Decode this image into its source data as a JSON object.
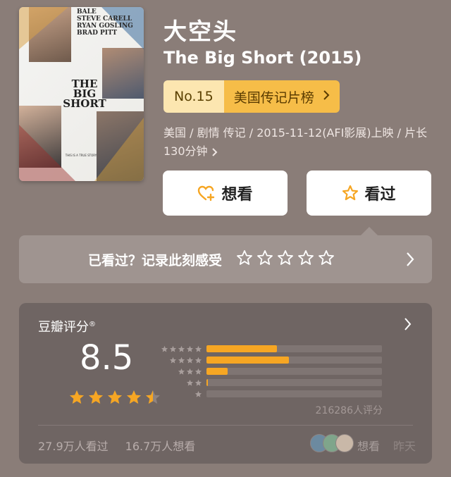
{
  "poster": {
    "names": [
      "BALE",
      "STEVE CARELL",
      "RYAN GOSLING",
      "BRAD PITT"
    ],
    "title": "THE BIG SHORT",
    "credits": "THIS IS A TRUE STORY"
  },
  "movie": {
    "title": "大空头",
    "subtitle": "The Big Short (2015)",
    "rank_no": "No.15",
    "rank_list": "美国传记片榜",
    "meta": "美国 / 剧情 传记 / 2015-11-12(AFI影展)上映 / 片长130分钟"
  },
  "actions": {
    "want_label": "想看",
    "seen_label": "看过"
  },
  "record": {
    "label": "已看过？记录此刻感受"
  },
  "rating": {
    "header": "豆瓣评分",
    "registered": "®",
    "score": "8.5",
    "stars_value": 4.5,
    "distribution": [
      {
        "stars": 5,
        "fraction": 0.4
      },
      {
        "stars": 4,
        "fraction": 0.47
      },
      {
        "stars": 3,
        "fraction": 0.12
      },
      {
        "stars": 2,
        "fraction": 0.01
      },
      {
        "stars": 1,
        "fraction": 0.0
      }
    ],
    "count": "216286人评分",
    "seen_count": "27.9万人看过",
    "want_count": "16.7万人想看",
    "want_label": "想看",
    "when": "昨天"
  },
  "colors": {
    "background": "#8a7d78",
    "accent": "#f6a623",
    "rank_badge": "#f6bd48"
  }
}
